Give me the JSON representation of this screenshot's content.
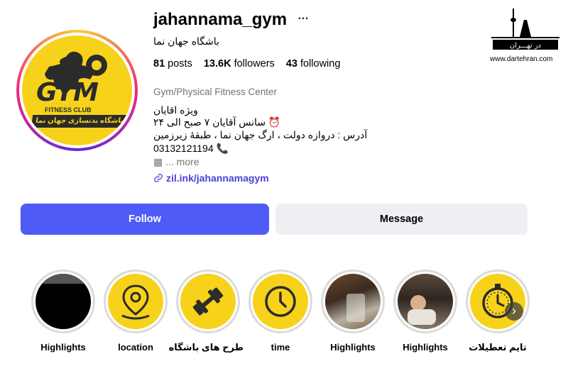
{
  "profile": {
    "username": "jahannama_gym",
    "more_icon": "…",
    "full_name": "باشگاه جهان نما",
    "avatar": {
      "logo_main": "GYM",
      "logo_sub": "FITNESS CLUB",
      "logo_banner": "باشگاه بدنسازی جهان نما"
    }
  },
  "stats": {
    "posts_count": "81",
    "posts_label": "posts",
    "followers_count": "13.6K",
    "followers_label": "followers",
    "following_count": "43",
    "following_label": "following"
  },
  "bio": {
    "category": "Gym/Physical Fitness Center",
    "line1": "ویژه اقایان",
    "line2": "⏰ سانس آقایان ۷ صبح الی ۲۴",
    "line3": "آدرس : دروازه دولت ، ارگ جهان نما ، طبقهٔ زیرزمین",
    "line4": "03132121194",
    "more_text": "... more",
    "link": "zil.ink/jahannamagym"
  },
  "watermark": {
    "brand": "در تهـــران",
    "site": "www.dartehran.com"
  },
  "buttons": {
    "follow": "Follow",
    "message": "Message"
  },
  "highlights": [
    {
      "label": "Highlights"
    },
    {
      "label": "location"
    },
    {
      "label": "طرح های باشگاه"
    },
    {
      "label": "time"
    },
    {
      "label": "Highlights"
    },
    {
      "label": "Highlights"
    },
    {
      "label": "تایم تعطیلات"
    }
  ],
  "colors": {
    "accent": "#4f5bf5",
    "link": "#4a3fd6",
    "highlight_yellow": "#f7d21a"
  }
}
